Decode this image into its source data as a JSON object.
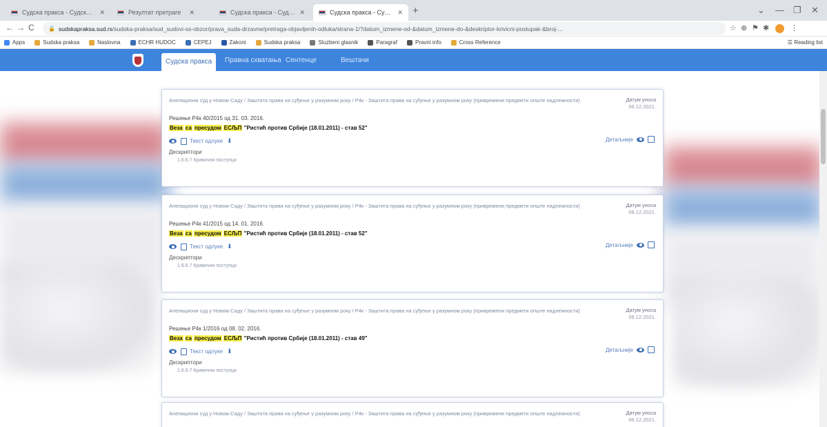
{
  "browser": {
    "tabs": [
      {
        "title": "Судска пракса - Судска пракса",
        "active": false
      },
      {
        "title": "Резултат претраге",
        "active": false
      },
      {
        "title": "Судска пракса - Судска пракса",
        "active": false
      },
      {
        "title": "Судска пракса - Судска пракса",
        "active": true
      }
    ],
    "new_tab": "+",
    "window_controls": [
      "⌄",
      "—",
      "❐",
      "✕"
    ],
    "nav_buttons": [
      "←",
      "→",
      "C"
    ],
    "url_host": "sudskapraksa.sud.rs",
    "url_path": "/sudska-praksa/sud_sudovi-ss-obzor/prava_suda-drzavne/pretraga-objavljenih-odluka/strana-1/?datum_izmene-od-&datum_izmene-do-&deskriptor-krivicni-postupak-&broj-...",
    "extensions": [
      "☆",
      "⊕",
      "⚑",
      "✱"
    ],
    "bookmarks": [
      "Apps",
      "Sudska praksa",
      "Naslovna",
      "ECHR HUDOC",
      "CEPEJ",
      "Zakoni",
      "Sudska praksa",
      "Sluzbeni glasnik",
      "Paragraf",
      "Pravni info",
      "Cross Reference"
    ],
    "reading_list": "Reading list"
  },
  "site": {
    "nav": [
      "Судска пракса",
      "Правна схватања",
      "Сентенце",
      "Вештачи"
    ]
  },
  "results": [
    {
      "court": "Апелациони суд у Новом Саду / Заштита права на суђење у разумном року / Р4к - Заштита права на суђење у разумном року (привремени предмети опште надлежности)",
      "date_label": "Датум уноса",
      "date": "06.12.2021.",
      "decision": "Решење Р4к 40/2015 од 31. 03. 2016.",
      "tag1": "Веза",
      "tag2": "са",
      "tag3": "пресудом",
      "tag4": "ЕСЉП",
      "case": "\"Ристић против Србије (18.01.2011) - став 52\"",
      "text_label": "Текст одлуке",
      "details": "Детаљније",
      "descriptors_label": "Дескриптори",
      "descriptor": "1.6.6.7 Кривични поступци"
    },
    {
      "court": "Апелациони суд у Новом Саду / Заштита права на суђење у разумном року / Р4к - Заштита права на суђење у разумном року (привремени предмети опште надлежности)",
      "date_label": "Датум уноса",
      "date": "06.12.2021.",
      "decision": "Решење Р4к 41/2015 од 14. 01. 2016.",
      "tag1": "Веза",
      "tag2": "са",
      "tag3": "пресудом",
      "tag4": "ЕСЉП",
      "case": "\"Ристић против Србије (18.01.2011) - став 52\"",
      "text_label": "Текст одлуке",
      "details": "Детаљније",
      "descriptors_label": "Дескриптори",
      "descriptor": "1.6.6.7 Кривични поступци"
    },
    {
      "court": "Апелациони суд у Новом Саду / Заштита права на суђење у разумном року / Р4к - Заштита права на суђење у разумном року (привремени предмети опште надлежности)",
      "date_label": "Датум уноса",
      "date": "06.12.2021.",
      "decision": "Решење Р4к 1/2016 од 08. 02. 2016.",
      "tag1": "Веза",
      "tag2": "са",
      "tag3": "пресудом",
      "tag4": "ЕСЉП",
      "case": "\"Ристић против Србије (18.01.2011) - став 49\"",
      "text_label": "Текст одлуке",
      "details": "Детаљније",
      "descriptors_label": "Дескриптори",
      "descriptor": "1.6.6.7 Кривични поступци"
    },
    {
      "court": "Апелациони суд у Новом Саду / Заштита права на суђење у разумном року / Р4к - Заштита права на суђење у разумном року (привремени предмети опште надлежности)",
      "date_label": "Датум уноса",
      "date": "06.12.2021."
    }
  ]
}
